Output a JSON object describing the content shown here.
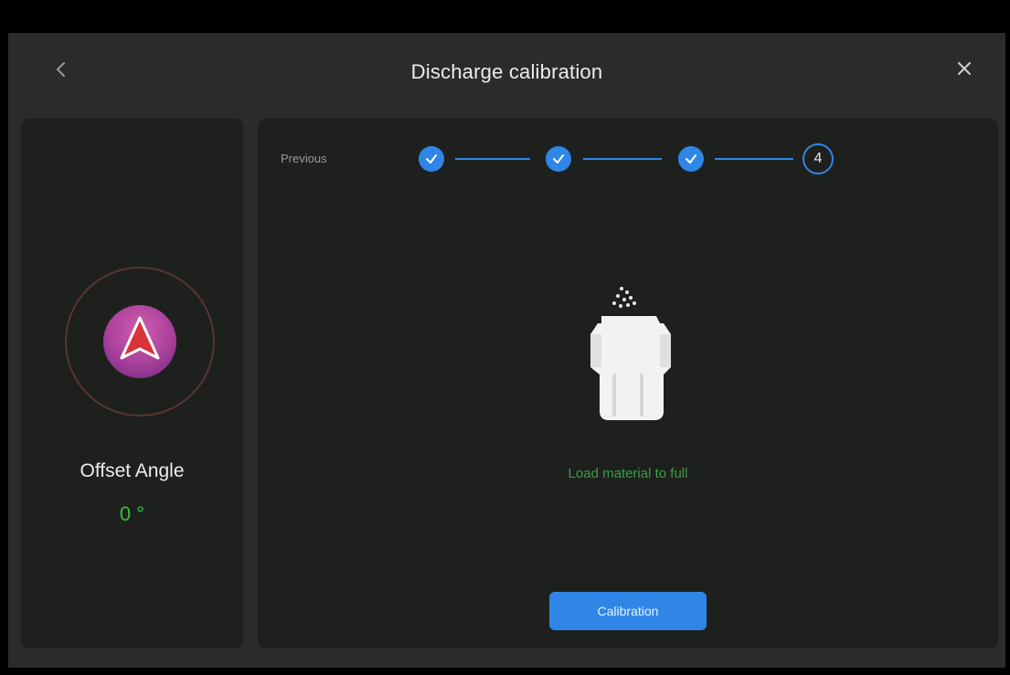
{
  "header": {
    "title": "Discharge calibration",
    "back_icon": "chevron-left-icon",
    "close_icon": "close-icon"
  },
  "left_panel": {
    "compass_icon": "navigation-arrow-icon",
    "offset_label": "Offset Angle",
    "offset_value": "0 °"
  },
  "steps": {
    "previous_label": "Previous",
    "items": [
      {
        "state": "done",
        "icon": "check-icon"
      },
      {
        "state": "done",
        "icon": "check-icon"
      },
      {
        "state": "done",
        "icon": "check-icon"
      },
      {
        "state": "current",
        "label": "4"
      }
    ]
  },
  "main": {
    "illustration_icon": "spreader-tank-icon",
    "instruction": "Load material to full",
    "calibration_button": "Calibration"
  },
  "colors": {
    "accent": "#2f86e6",
    "success_text": "#3cbf3c",
    "panel_bg": "#1e201e",
    "frame_bg": "#2a2c2a"
  }
}
